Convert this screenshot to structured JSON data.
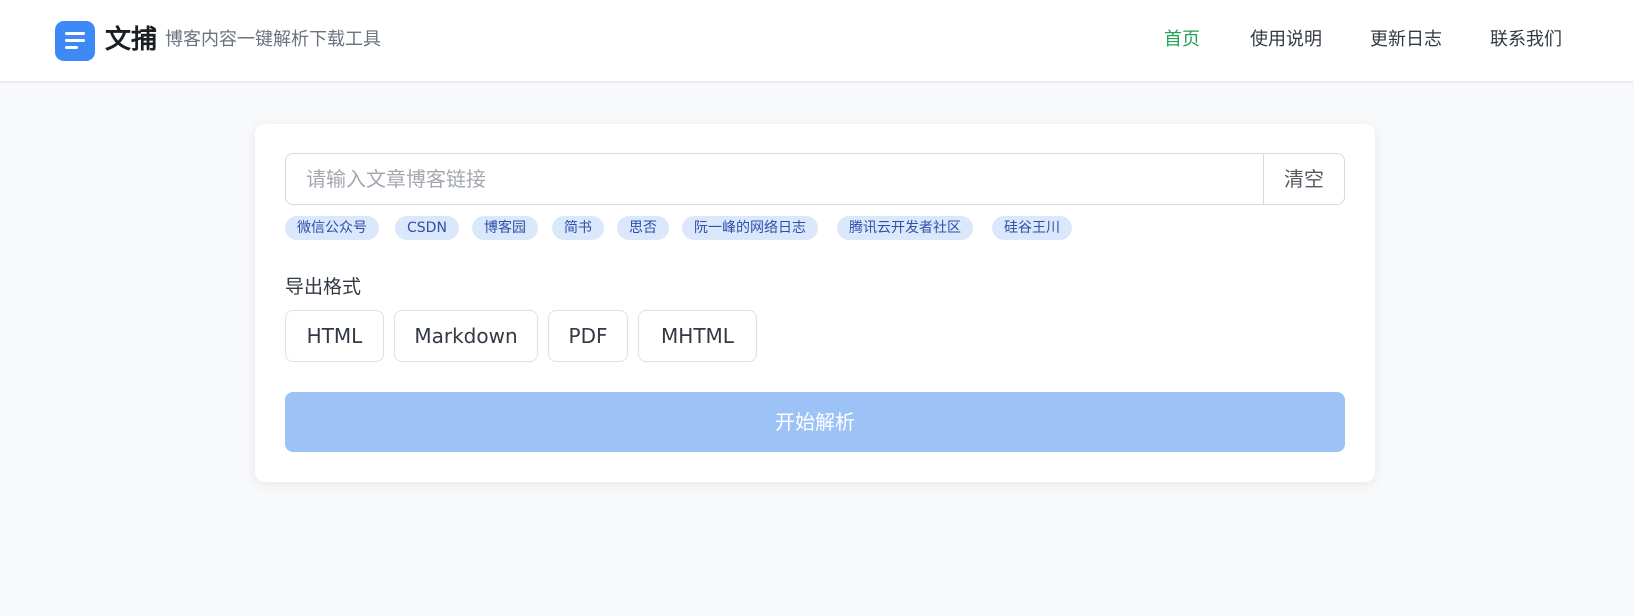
{
  "header": {
    "brand_title": "文捕",
    "brand_subtitle": "博客内容一键解析下载工具",
    "nav": [
      {
        "label": "首页",
        "active": true
      },
      {
        "label": "使用说明",
        "active": false
      },
      {
        "label": "更新日志",
        "active": false
      },
      {
        "label": "联系我们",
        "active": false
      }
    ]
  },
  "search": {
    "placeholder": "请输入文章博客链接",
    "value": "",
    "clear_label": "清空"
  },
  "tags": [
    "微信公众号",
    "CSDN",
    "博客园",
    "简书",
    "思否",
    "阮一峰的网络日志",
    "腾讯云开发者社区",
    "硅谷王川"
  ],
  "export": {
    "label": "导出格式",
    "formats": [
      "HTML",
      "Markdown",
      "PDF",
      "MHTML"
    ]
  },
  "start_button": "开始解析",
  "colors": {
    "accent": "#3d8af7",
    "nav_active": "#22a355",
    "start_button_bg": "#9cc2f6",
    "tag_bg": "#dbe8fb",
    "tag_text": "#2f4fa8"
  },
  "icons": {
    "logo": "document-lines-icon"
  }
}
